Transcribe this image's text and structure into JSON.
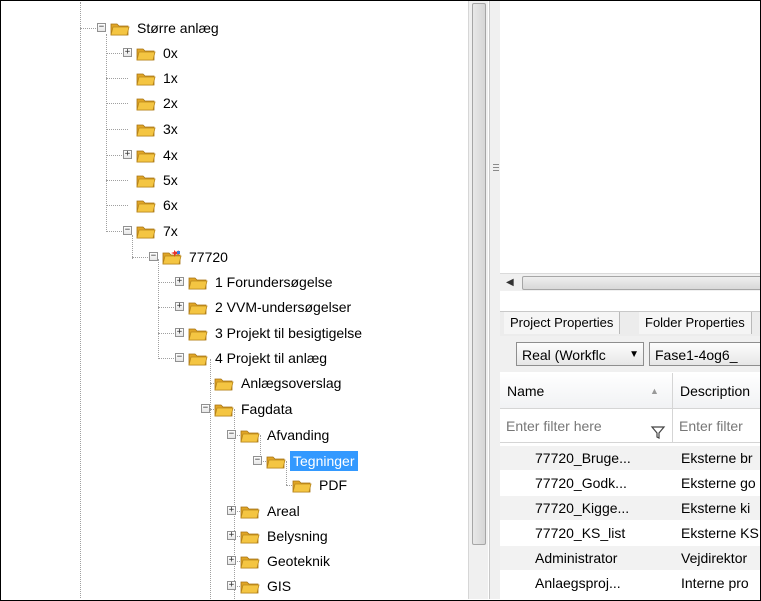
{
  "tree": {
    "nodes": [
      {
        "label": "Større anlæg",
        "expander": "−"
      },
      {
        "label": "0x",
        "expander": "+"
      },
      {
        "label": "1x",
        "expander": ""
      },
      {
        "label": "2x",
        "expander": ""
      },
      {
        "label": "3x",
        "expander": ""
      },
      {
        "label": "4x",
        "expander": "+"
      },
      {
        "label": "5x",
        "expander": ""
      },
      {
        "label": "6x",
        "expander": ""
      },
      {
        "label": "7x",
        "expander": "−"
      },
      {
        "label": "77720",
        "expander": "−"
      },
      {
        "label": "1 Forundersøgelse",
        "expander": "+"
      },
      {
        "label": "2 VVM-undersøgelser",
        "expander": "+"
      },
      {
        "label": "3 Projekt til besigtigelse",
        "expander": "+"
      },
      {
        "label": "4 Projekt til anlæg",
        "expander": "−"
      },
      {
        "label": "Anlægsoverslag",
        "expander": ""
      },
      {
        "label": "Fagdata",
        "expander": "−"
      },
      {
        "label": "Afvanding",
        "expander": "−"
      },
      {
        "label": "Tegninger",
        "expander": "−"
      },
      {
        "label": "PDF",
        "expander": ""
      },
      {
        "label": "Areal",
        "expander": "+"
      },
      {
        "label": "Belysning",
        "expander": "+"
      },
      {
        "label": "Geoteknik",
        "expander": "+"
      },
      {
        "label": "GIS",
        "expander": "+"
      }
    ]
  },
  "tabs": {
    "project_properties": "Project Properties",
    "folder_properties": "Folder Properties"
  },
  "selectors": {
    "workflow": "Real (Workflc",
    "state": "Fase1-4og6_"
  },
  "grid": {
    "headers": {
      "name": "Name",
      "description": "Description"
    },
    "filter_placeholder": "Enter filter here",
    "filter_placeholder_2": "Enter filter",
    "rows": [
      {
        "name": "77720_Bruge...",
        "description": "Eksterne br"
      },
      {
        "name": "77720_Godk...",
        "description": "Eksterne go"
      },
      {
        "name": "77720_Kigge...",
        "description": "Eksterne ki"
      },
      {
        "name": "77720_KS_list",
        "description": "Eksterne KS"
      },
      {
        "name": "Administrator",
        "description": "Vejdirektor"
      },
      {
        "name": "Anlaegsproj...",
        "description": "Interne pro"
      }
    ]
  },
  "colors": {
    "selection": "#3399ff",
    "folder_body": "#f4c542",
    "folder_tab": "#e0a526"
  }
}
